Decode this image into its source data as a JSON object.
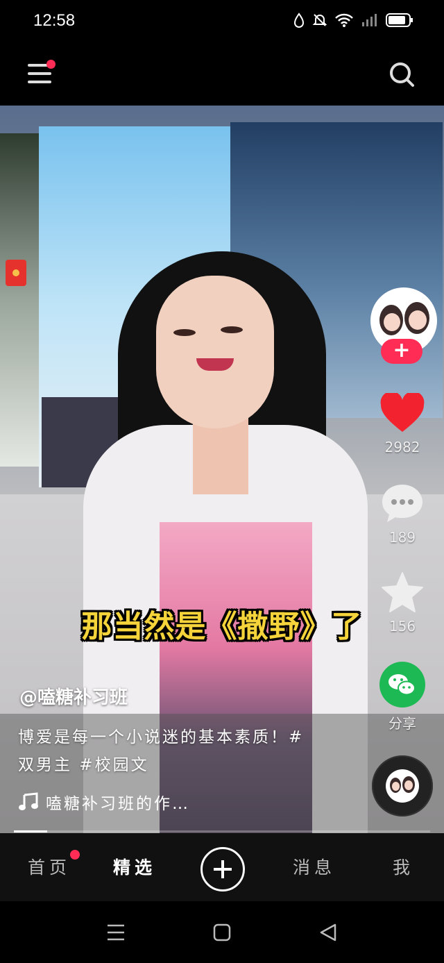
{
  "status_bar": {
    "time": "12:58"
  },
  "video": {
    "caption": "那当然是《撒野》了",
    "author": "@嗑糖补习班",
    "description": "博爱是每一个小说迷的基本素质！#双男主 #校园文",
    "music": "嗑糖补习班的作…",
    "progress": 0.08
  },
  "actions": {
    "like_count": "2982",
    "comment_count": "189",
    "favorite_count": "156",
    "share_label": "分享"
  },
  "tabs": [
    {
      "label": "首页",
      "has_dot": true
    },
    {
      "label": "精选",
      "active": true
    },
    {
      "label": "消息"
    },
    {
      "label": "我"
    }
  ],
  "colors": {
    "accent": "#ff2d55",
    "caption": "#f5d33a",
    "share": "#1db954"
  }
}
